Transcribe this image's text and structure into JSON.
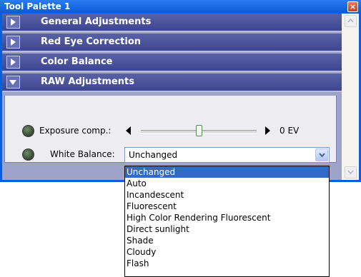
{
  "window": {
    "title": "Tool Palette 1",
    "close_glyph": "×"
  },
  "sections": [
    {
      "label": "General Adjustments",
      "expanded": false,
      "icon": "chevron-right-icon"
    },
    {
      "label": "Red Eye Correction",
      "expanded": false,
      "icon": "chevron-right-icon"
    },
    {
      "label": "Color Balance",
      "expanded": false,
      "icon": "chevron-right-icon"
    },
    {
      "label": "RAW Adjustments",
      "expanded": true,
      "icon": "chevron-down-icon"
    }
  ],
  "raw": {
    "exposure_label": "Exposure comp.:",
    "exposure_value": "0 EV",
    "exposure_fraction": 0.5,
    "wb_label": "White Balance:",
    "wb_value": "Unchanged"
  },
  "dropdown_options": [
    "Unchanged",
    "Auto",
    "Incandescent",
    "Fluorescent",
    "High Color Rendering Fluorescent",
    "Direct sunlight",
    "Shade",
    "Cloudy",
    "Flash"
  ],
  "colors": {
    "title_bar": "#0a58d6",
    "section_header": "#4a52a0",
    "selected_item": "#316ac5"
  }
}
